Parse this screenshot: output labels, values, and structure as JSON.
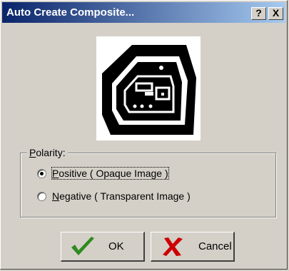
{
  "window": {
    "title": "Auto Create Composite...",
    "help_label": "?",
    "close_label": "X"
  },
  "polarity": {
    "legend_prefix": "P",
    "legend_rest": "olarity:",
    "options": [
      {
        "mnemonic": "P",
        "rest": "ositive ( Opaque Image )",
        "selected": true
      },
      {
        "mnemonic": "N",
        "rest": "egative ( Transparent Image )",
        "selected": false
      }
    ]
  },
  "buttons": {
    "ok_label": "OK",
    "cancel_label": "Cancel"
  },
  "colors": {
    "ok_icon": "#2e8b1e",
    "cancel_icon": "#cc0000",
    "title_start": "#0a246a",
    "title_end": "#a6caf0"
  }
}
